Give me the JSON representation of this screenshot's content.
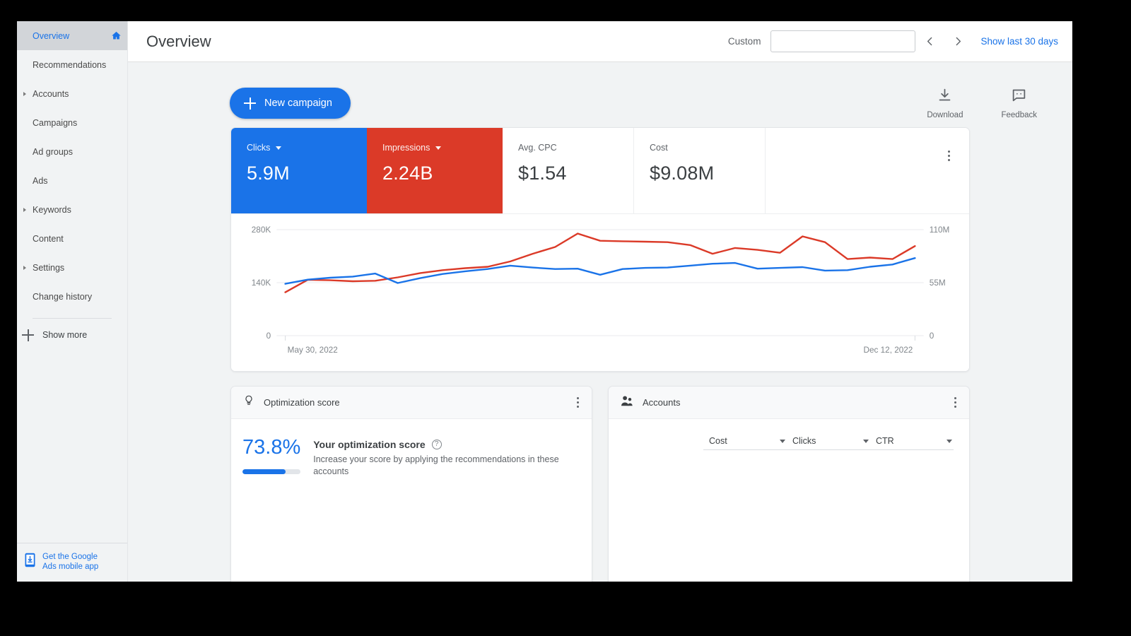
{
  "app": {
    "accent_blue": "#1a73e8",
    "accent_red": "#db3a28"
  },
  "sidebar": {
    "items": [
      {
        "label": "Overview",
        "active": true,
        "expandable": false,
        "icon": "home-icon"
      },
      {
        "label": "Recommendations",
        "active": false,
        "expandable": false
      },
      {
        "label": "Accounts",
        "active": false,
        "expandable": true
      },
      {
        "label": "Campaigns",
        "active": false,
        "expandable": false
      },
      {
        "label": "Ad groups",
        "active": false,
        "expandable": false
      },
      {
        "label": "Ads",
        "active": false,
        "expandable": false
      },
      {
        "label": "Keywords",
        "active": false,
        "expandable": true
      },
      {
        "label": "Content",
        "active": false,
        "expandable": false
      },
      {
        "label": "Settings",
        "active": false,
        "expandable": true
      },
      {
        "label": "Change history",
        "active": false,
        "expandable": false
      }
    ],
    "show_more_label": "Show more",
    "promo": {
      "line1": "Get the Google",
      "line2": "Ads mobile app"
    }
  },
  "header": {
    "title": "Overview",
    "date_range_label": "Custom",
    "date_range_value": "",
    "date_range_placeholder": "",
    "prev_label": "‹",
    "next_label": "›",
    "show_last_30_label": "Show last 30 days"
  },
  "toolbar": {
    "new_campaign_label": "New campaign",
    "download_label": "Download",
    "feedback_label": "Feedback"
  },
  "metrics": [
    {
      "label": "Clicks",
      "value": "5.9M",
      "selected": true,
      "color": "#1a73e8"
    },
    {
      "label": "Impressions",
      "value": "2.24B",
      "selected": true,
      "color": "#db3a28"
    },
    {
      "label": "Avg. CPC",
      "value": "$1.54",
      "selected": false,
      "color": ""
    },
    {
      "label": "Cost",
      "value": "$9.08M",
      "selected": false,
      "color": ""
    }
  ],
  "chart_data": {
    "type": "line",
    "title": "",
    "xlabel": "",
    "ylabel": "",
    "grid": true,
    "legend_position": "none",
    "x_tick_labels": [
      "May 30, 2022",
      "Dec 12, 2022"
    ],
    "left_axis": {
      "name": "Clicks",
      "tick_labels": [
        "0",
        "140K",
        "280K"
      ],
      "tick_values": [
        0,
        140000,
        280000
      ],
      "ylim": [
        0,
        280000
      ],
      "color": "#1a73e8"
    },
    "right_axis": {
      "name": "Impressions",
      "tick_labels": [
        "0",
        "55M",
        "110M"
      ],
      "tick_values": [
        0,
        55000000,
        110000000
      ],
      "ylim": [
        0,
        110000000
      ],
      "color": "#db3a28"
    },
    "series": [
      {
        "name": "Clicks",
        "axis": "left",
        "color": "#1a73e8",
        "values": [
          137000,
          148000,
          153000,
          156000,
          164000,
          139000,
          152000,
          163000,
          170000,
          176000,
          185000,
          180000,
          176000,
          177000,
          161000,
          176000,
          179000,
          180000,
          185000,
          190000,
          192000,
          177000,
          179000,
          181000,
          172000,
          173000,
          182000,
          188000,
          205000
        ]
      },
      {
        "name": "Impressions",
        "axis": "right",
        "color": "#db3a28",
        "values": [
          45000000,
          58000000,
          57500000,
          56500000,
          57000000,
          60500000,
          65000000,
          68000000,
          70000000,
          71500000,
          77000000,
          85000000,
          92000000,
          106000000,
          98500000,
          98000000,
          97500000,
          97000000,
          94000000,
          85000000,
          91000000,
          89000000,
          86000000,
          103000000,
          97000000,
          79500000,
          81000000,
          79500000,
          93000000
        ]
      }
    ]
  },
  "optimization_panel": {
    "title": "Optimization score",
    "icon": "lightbulb-icon",
    "score": "73.8%",
    "score_percent": 73.8,
    "heading": "Your optimization score",
    "description": "Increase your score by applying the recommendations in these accounts"
  },
  "accounts_panel": {
    "title": "Accounts",
    "icon": "people-icon",
    "columns": [
      {
        "label": "Cost",
        "has_dropdown": true
      },
      {
        "label": "Clicks",
        "has_dropdown": true
      },
      {
        "label": "CTR",
        "has_dropdown": true
      }
    ]
  }
}
